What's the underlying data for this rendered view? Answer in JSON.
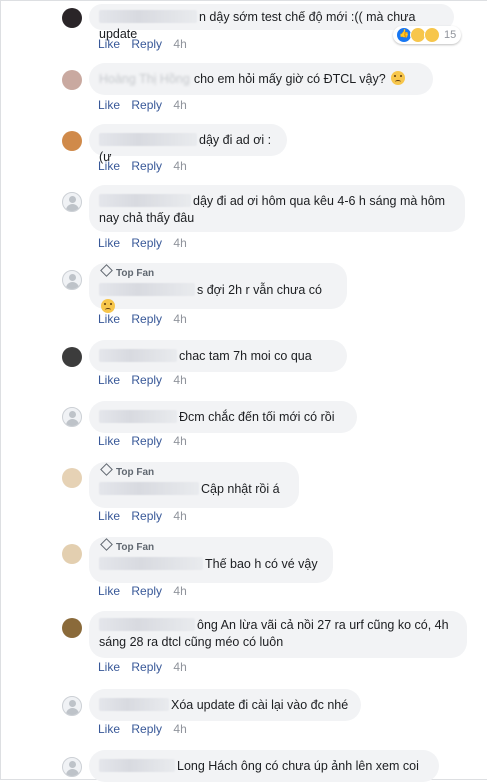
{
  "actions": {
    "like": "Like",
    "reply": "Reply"
  },
  "top_fan_label": "Top Fan",
  "comments": [
    {
      "text": "n dậy sớm test chế độ mới :(( mà chưa update",
      "time": "4h",
      "reaction_count": "15"
    },
    {
      "name": "Hoàng Thị Hồng",
      "text": "cho em hỏi mấy giờ có ĐTCL vậy?",
      "time": "4h"
    },
    {
      "text": "dậy đi ad ơi :(ư",
      "time": "4h"
    },
    {
      "text": "dậy đi ad ơi hôm qua kêu 4-6 h sáng mà hôm nay chả thấy đâu",
      "time": "4h"
    },
    {
      "text": "s đợi 2h r vẫn chưa có",
      "time": "4h"
    },
    {
      "text": "chac tam 7h moi co qua",
      "time": "4h"
    },
    {
      "text": "Đcm chắc đến tối mới có rồi",
      "time": "4h"
    },
    {
      "text": "Cập nhật rồi á",
      "time": "4h"
    },
    {
      "text": "Thế bao h có vé vậy",
      "time": "4h"
    },
    {
      "text": "ông An lừa vãi cả nồi 27 ra urf cũng ko có, 4h sáng 28 ra dtcl cũng méo có luôn",
      "time": "4h"
    },
    {
      "text": "Xóa update đi cài lại vào đc nhé",
      "time": "4h"
    },
    {
      "text": "Long Hách ông có chưa úp ảnh lên xem coi"
    }
  ]
}
